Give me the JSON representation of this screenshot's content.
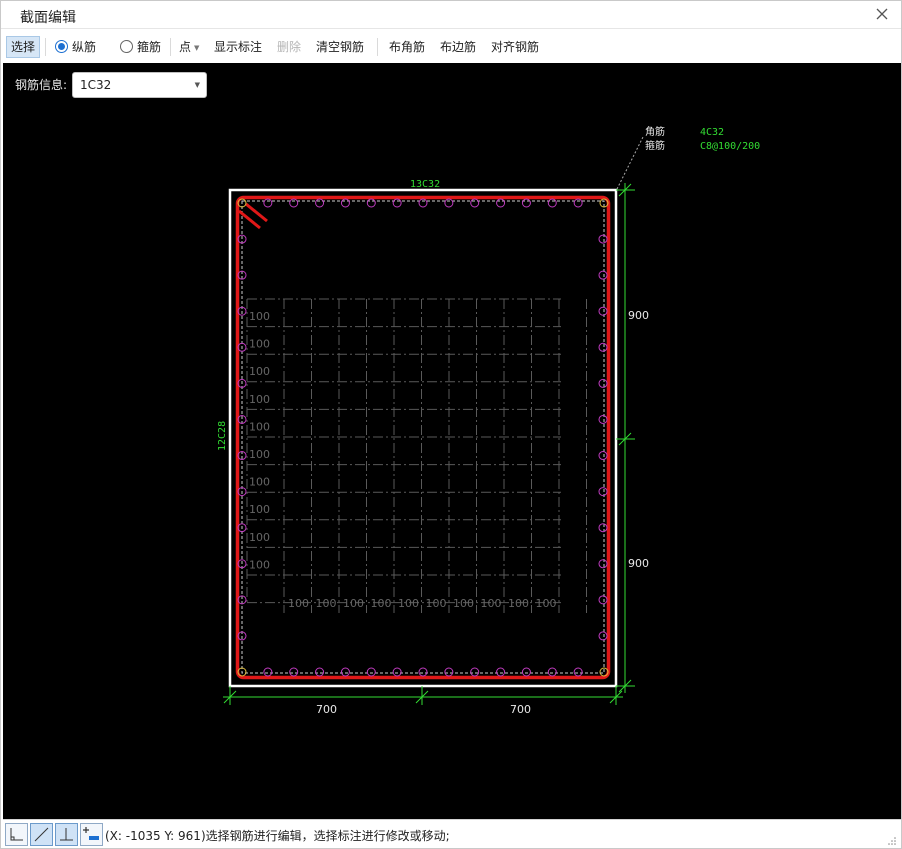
{
  "window": {
    "title": "截面编辑"
  },
  "toolbar": {
    "select": "选择",
    "longitudinal": "纵筋",
    "stirrup": "箍筋",
    "point": "点",
    "show_dim": "显示标注",
    "delete": "删除",
    "clear": "清空钢筋",
    "corner": "布角筋",
    "edge": "布边筋",
    "align": "对齐钢筋"
  },
  "rebar_info": {
    "label": "钢筋信息:",
    "value": "1C32"
  },
  "drawing": {
    "leader": {
      "corner_label": "角筋",
      "corner_value": "4C32",
      "stirrup_label": "箍筋",
      "stirrup_value": "C8@100/200"
    },
    "top_rebar_label": "13C32",
    "left_rebar_label": "12C28",
    "dim_right_top": "900",
    "dim_right_bottom": "900",
    "dim_bottom_left": "700",
    "dim_bottom_right": "700",
    "grid_label": "100",
    "colors": {
      "background": "#000000",
      "section": "#ffffff",
      "stirrup": "#e01818",
      "rebar": "#c03cc0",
      "dimension": "#33dd33",
      "grid": "#5a5a5a"
    }
  },
  "status": {
    "text": "(X: -1035 Y: 961)选择钢筋进行编辑，选择标注进行修改或移动;"
  },
  "icons": [
    "close-icon",
    "ortho-icon",
    "slope-icon",
    "perpendicular-icon",
    "add-dimension-icon",
    "resize-grip-icon"
  ]
}
